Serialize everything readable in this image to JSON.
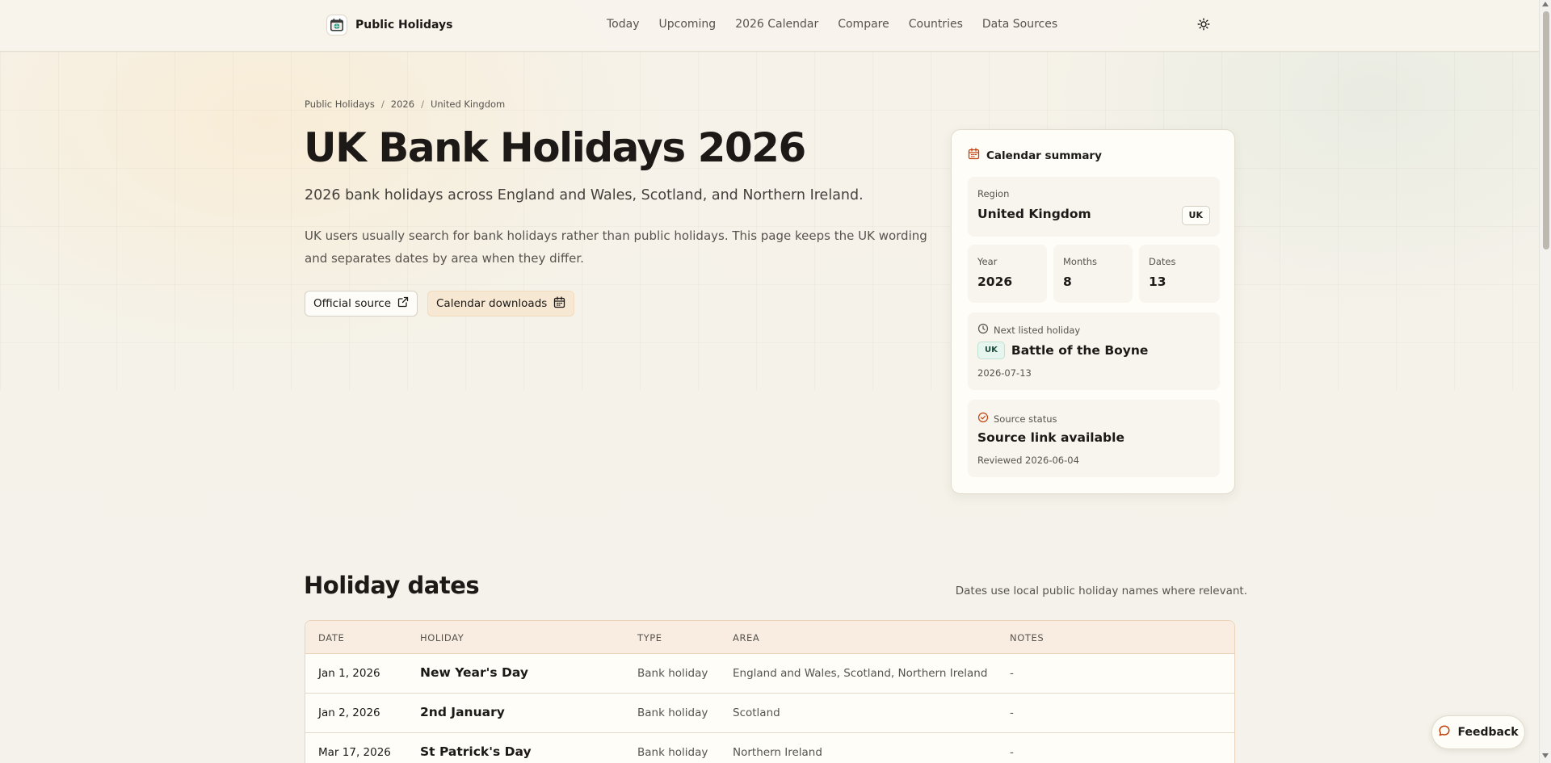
{
  "header": {
    "brand": "Public Holidays",
    "nav": [
      "Today",
      "Upcoming",
      "2026 Calendar",
      "Compare",
      "Countries",
      "Data Sources"
    ],
    "icons": {
      "logo": "calendar-globe-icon",
      "theme": "sun-icon"
    }
  },
  "breadcrumb": [
    "Public Holidays",
    "2026",
    "United Kingdom"
  ],
  "hero": {
    "title": "UK Bank Holidays 2026",
    "subtitle": "2026 bank holidays across England and Wales, Scotland, and Northern Ireland.",
    "description": "UK users usually search for bank holidays rather than public holidays. This page keeps the UK wording and separates dates by area when they differ.",
    "official_source": "Official source",
    "calendar_downloads": "Calendar downloads"
  },
  "summary": {
    "title": "Calendar summary",
    "region_label": "Region",
    "region_value": "United Kingdom",
    "region_code": "UK",
    "year_label": "Year",
    "year_value": "2026",
    "months_label": "Months",
    "months_value": "8",
    "dates_label": "Dates",
    "dates_value": "13",
    "next_label": "Next listed holiday",
    "next_tag": "UK",
    "next_name": "Battle of the Boyne",
    "next_date": "2026-07-13",
    "source_label": "Source status",
    "source_value": "Source link available",
    "source_reviewed": "Reviewed 2026-06-04"
  },
  "holidays": {
    "title": "Holiday dates",
    "note": "Dates use local public holiday names where relevant.",
    "columns": [
      "DATE",
      "HOLIDAY",
      "TYPE",
      "AREA",
      "NOTES"
    ],
    "rows": [
      {
        "date": "Jan 1, 2026",
        "name": "New Year's Day",
        "type": "Bank holiday",
        "area": "England and Wales, Scotland, Northern Ireland",
        "notes": "-"
      },
      {
        "date": "Jan 2, 2026",
        "name": "2nd January",
        "type": "Bank holiday",
        "area": "Scotland",
        "notes": "-"
      },
      {
        "date": "Mar 17, 2026",
        "name": "St Patrick's Day",
        "type": "Bank holiday",
        "area": "Northern Ireland",
        "notes": "-"
      }
    ]
  },
  "feedback": "Feedback",
  "colors": {
    "accent_red": "#c2410c",
    "tag_green": "#e6f5ee",
    "soft_peach": "#f7e8d3"
  }
}
